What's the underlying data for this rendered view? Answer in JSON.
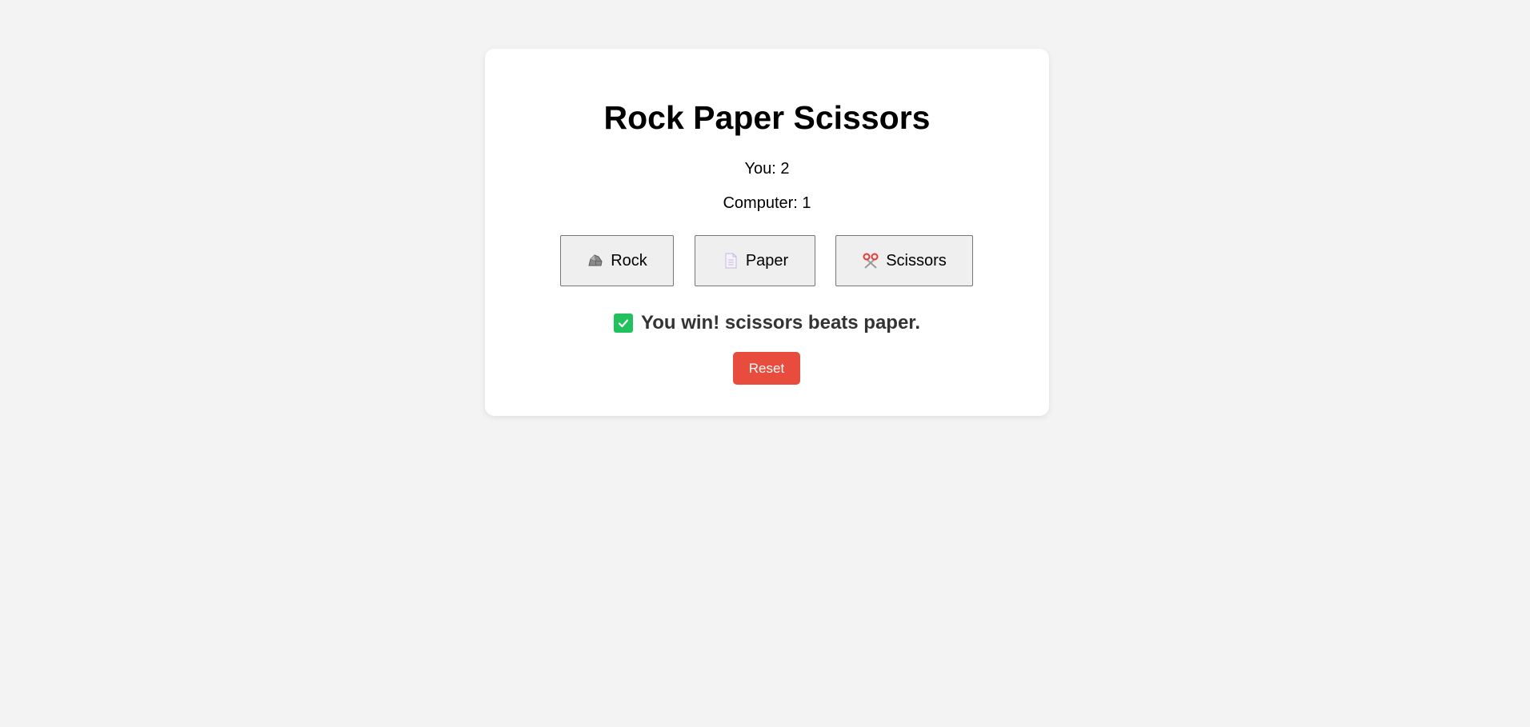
{
  "game": {
    "title": "Rock Paper Scissors",
    "score_you": "You: 2",
    "score_computer": "Computer: 1",
    "choices": [
      {
        "label": "Rock",
        "icon": "rock-icon"
      },
      {
        "label": "Paper",
        "icon": "page-icon"
      },
      {
        "label": "Scissors",
        "icon": "scissors-icon"
      }
    ],
    "result_icon": "check-mark-icon",
    "result_text": "You win! scissors beats paper.",
    "reset_label": "Reset"
  },
  "colors": {
    "background": "#f3f3f3",
    "card": "#ffffff",
    "check_green": "#21c25e",
    "reset_red": "#e74c3c",
    "result_text": "#333333"
  }
}
